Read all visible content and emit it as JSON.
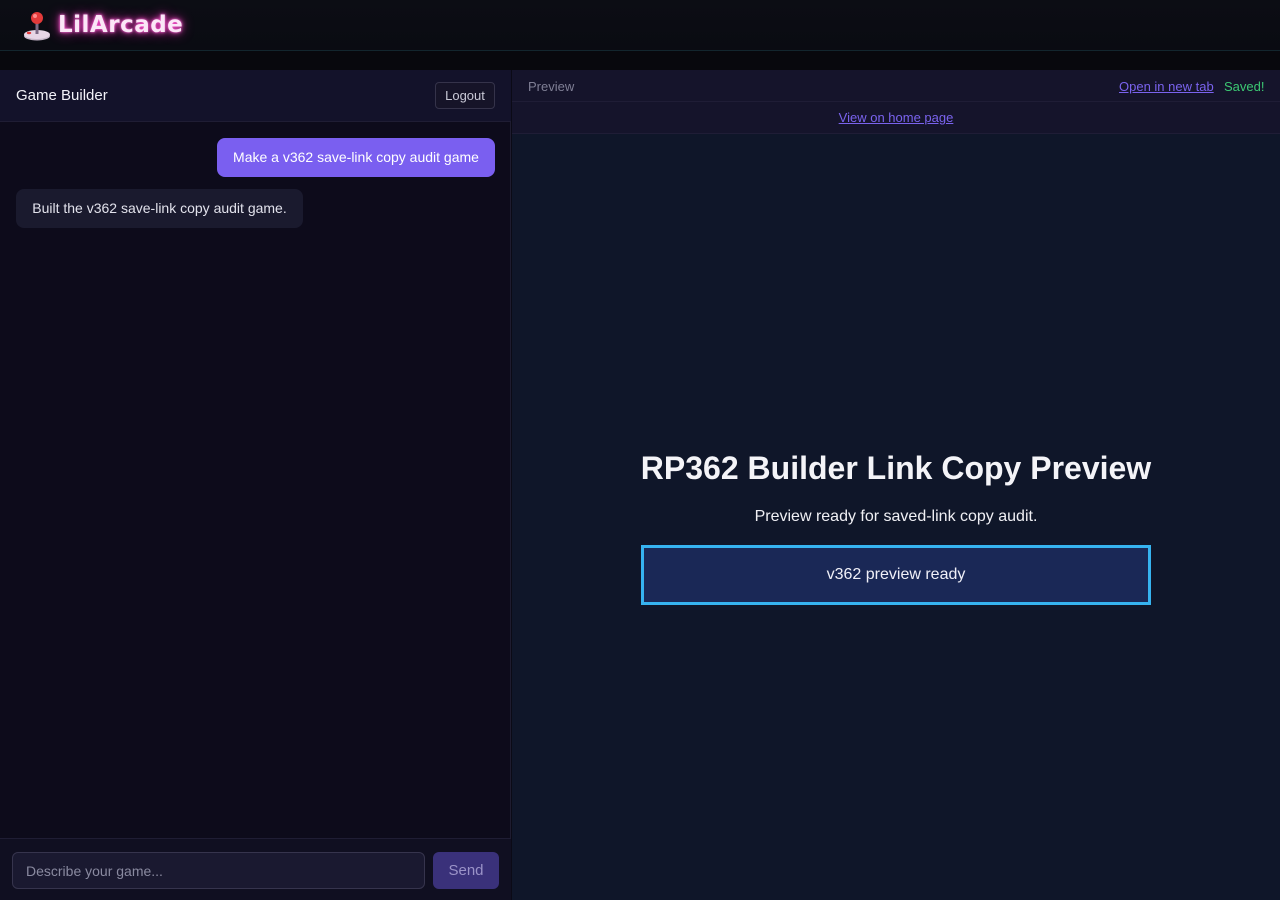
{
  "header": {
    "brand_name": "LilArcade",
    "brand_icon": "joystick-icon"
  },
  "builder": {
    "title": "Game Builder",
    "logout_label": "Logout",
    "messages": [
      {
        "role": "user",
        "text": "Make a v362 save-link copy audit game"
      },
      {
        "role": "assistant",
        "text": "Built the v362 save-link copy audit game."
      }
    ],
    "composer": {
      "placeholder": "Describe your game...",
      "value": "",
      "send_label": "Send"
    }
  },
  "preview": {
    "label": "Preview",
    "open_new_tab_label": "Open in new tab",
    "saved_status": "Saved!",
    "home_link_label": "View on home page",
    "game": {
      "title": "RP362 Builder Link Copy Preview",
      "subtitle": "Preview ready for saved-link copy audit.",
      "status_text": "v362 preview ready"
    }
  },
  "colors": {
    "accent": "#7a5ff0",
    "link": "#7a63ee",
    "saved": "#3cc873",
    "status_border": "#36b3f0",
    "logo_glow": "#ff4fd1"
  }
}
